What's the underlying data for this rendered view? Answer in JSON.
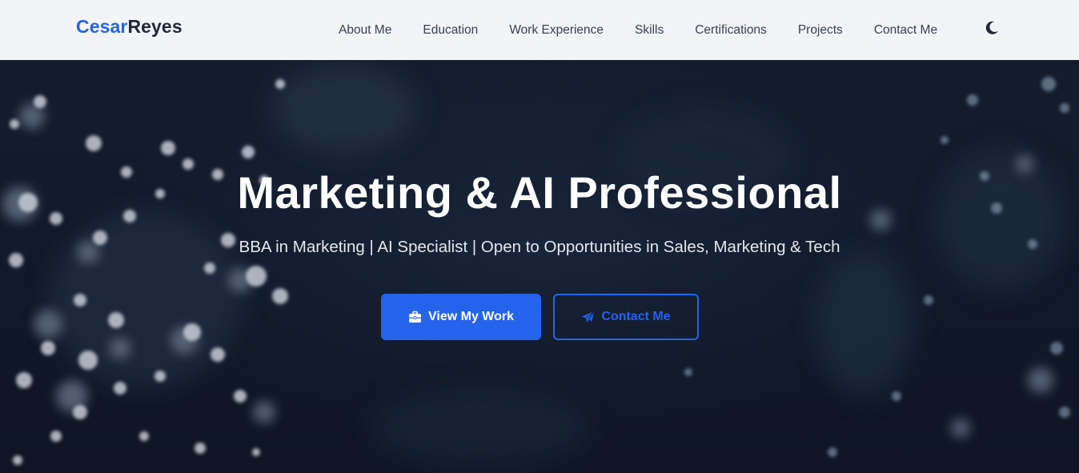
{
  "brand": {
    "first": "Cesar",
    "last": "Reyes"
  },
  "nav": {
    "items": [
      {
        "label": "About Me"
      },
      {
        "label": "Education"
      },
      {
        "label": "Work Experience"
      },
      {
        "label": "Skills"
      },
      {
        "label": "Certifications"
      },
      {
        "label": "Projects"
      },
      {
        "label": "Contact Me"
      }
    ],
    "theme_toggle_icon": "moon-icon"
  },
  "hero": {
    "title": "Marketing & AI Professional",
    "subtitle": "BBA in Marketing | AI Specialist | Open to Opportunities in Sales, Marketing & Tech",
    "primary_button": {
      "label": "View My Work",
      "icon": "briefcase-icon"
    },
    "secondary_button": {
      "label": "Contact Me",
      "icon": "paper-plane-icon"
    }
  },
  "colors": {
    "accent": "#2563eb",
    "navbar_bg": "#f3f4f6",
    "hero_bg": "#111827",
    "text_dark": "#1f2937"
  }
}
